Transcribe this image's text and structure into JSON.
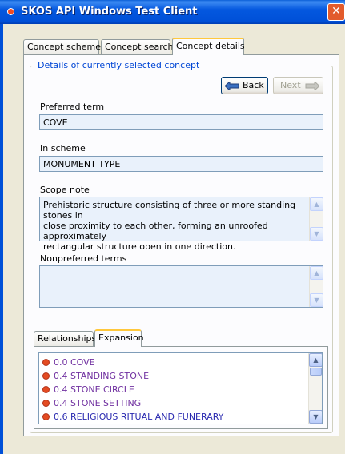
{
  "window": {
    "title": "SKOS API Windows Test Client",
    "close_label": "✕"
  },
  "tabs": [
    {
      "label": "Concept schemes",
      "active": false
    },
    {
      "label": "Concept search",
      "active": false
    },
    {
      "label": "Concept details",
      "active": true
    }
  ],
  "details": {
    "group_title": "Details of currently selected concept",
    "back_label": "Back",
    "next_label": "Next",
    "preferred_term_label": "Preferred term",
    "preferred_term_value": "COVE",
    "in_scheme_label": "In scheme",
    "in_scheme_value": "MONUMENT TYPE",
    "scope_note_label": "Scope note",
    "scope_note_lines": [
      "Prehistoric structure consisting of three or more standing stones in",
      "close proximity to each other, forming an unroofed approximately",
      "rectangular structure open in one direction."
    ],
    "nonpreferred_label": "Nonpreferred terms",
    "nonpreferred_value": ""
  },
  "subtabs": [
    {
      "label": "Relationships",
      "active": false
    },
    {
      "label": "Expansion",
      "active": true
    }
  ],
  "expansion": {
    "items": [
      "0.0 COVE",
      "0.4 STANDING STONE",
      "0.4 STONE CIRCLE",
      "0.4 STONE SETTING",
      "0.6 RELIGIOUS RITUAL AND FUNERARY"
    ],
    "item_colors": [
      "#7030A0",
      "#7030A0",
      "#7030A0",
      "#7030A0",
      "#2A2AB0"
    ]
  },
  "colors": {
    "title_bar": "#0458DF",
    "legend": "#0046D5",
    "field_bg": "#E9F1FB",
    "active_tab_accent": "#FFC83C"
  }
}
